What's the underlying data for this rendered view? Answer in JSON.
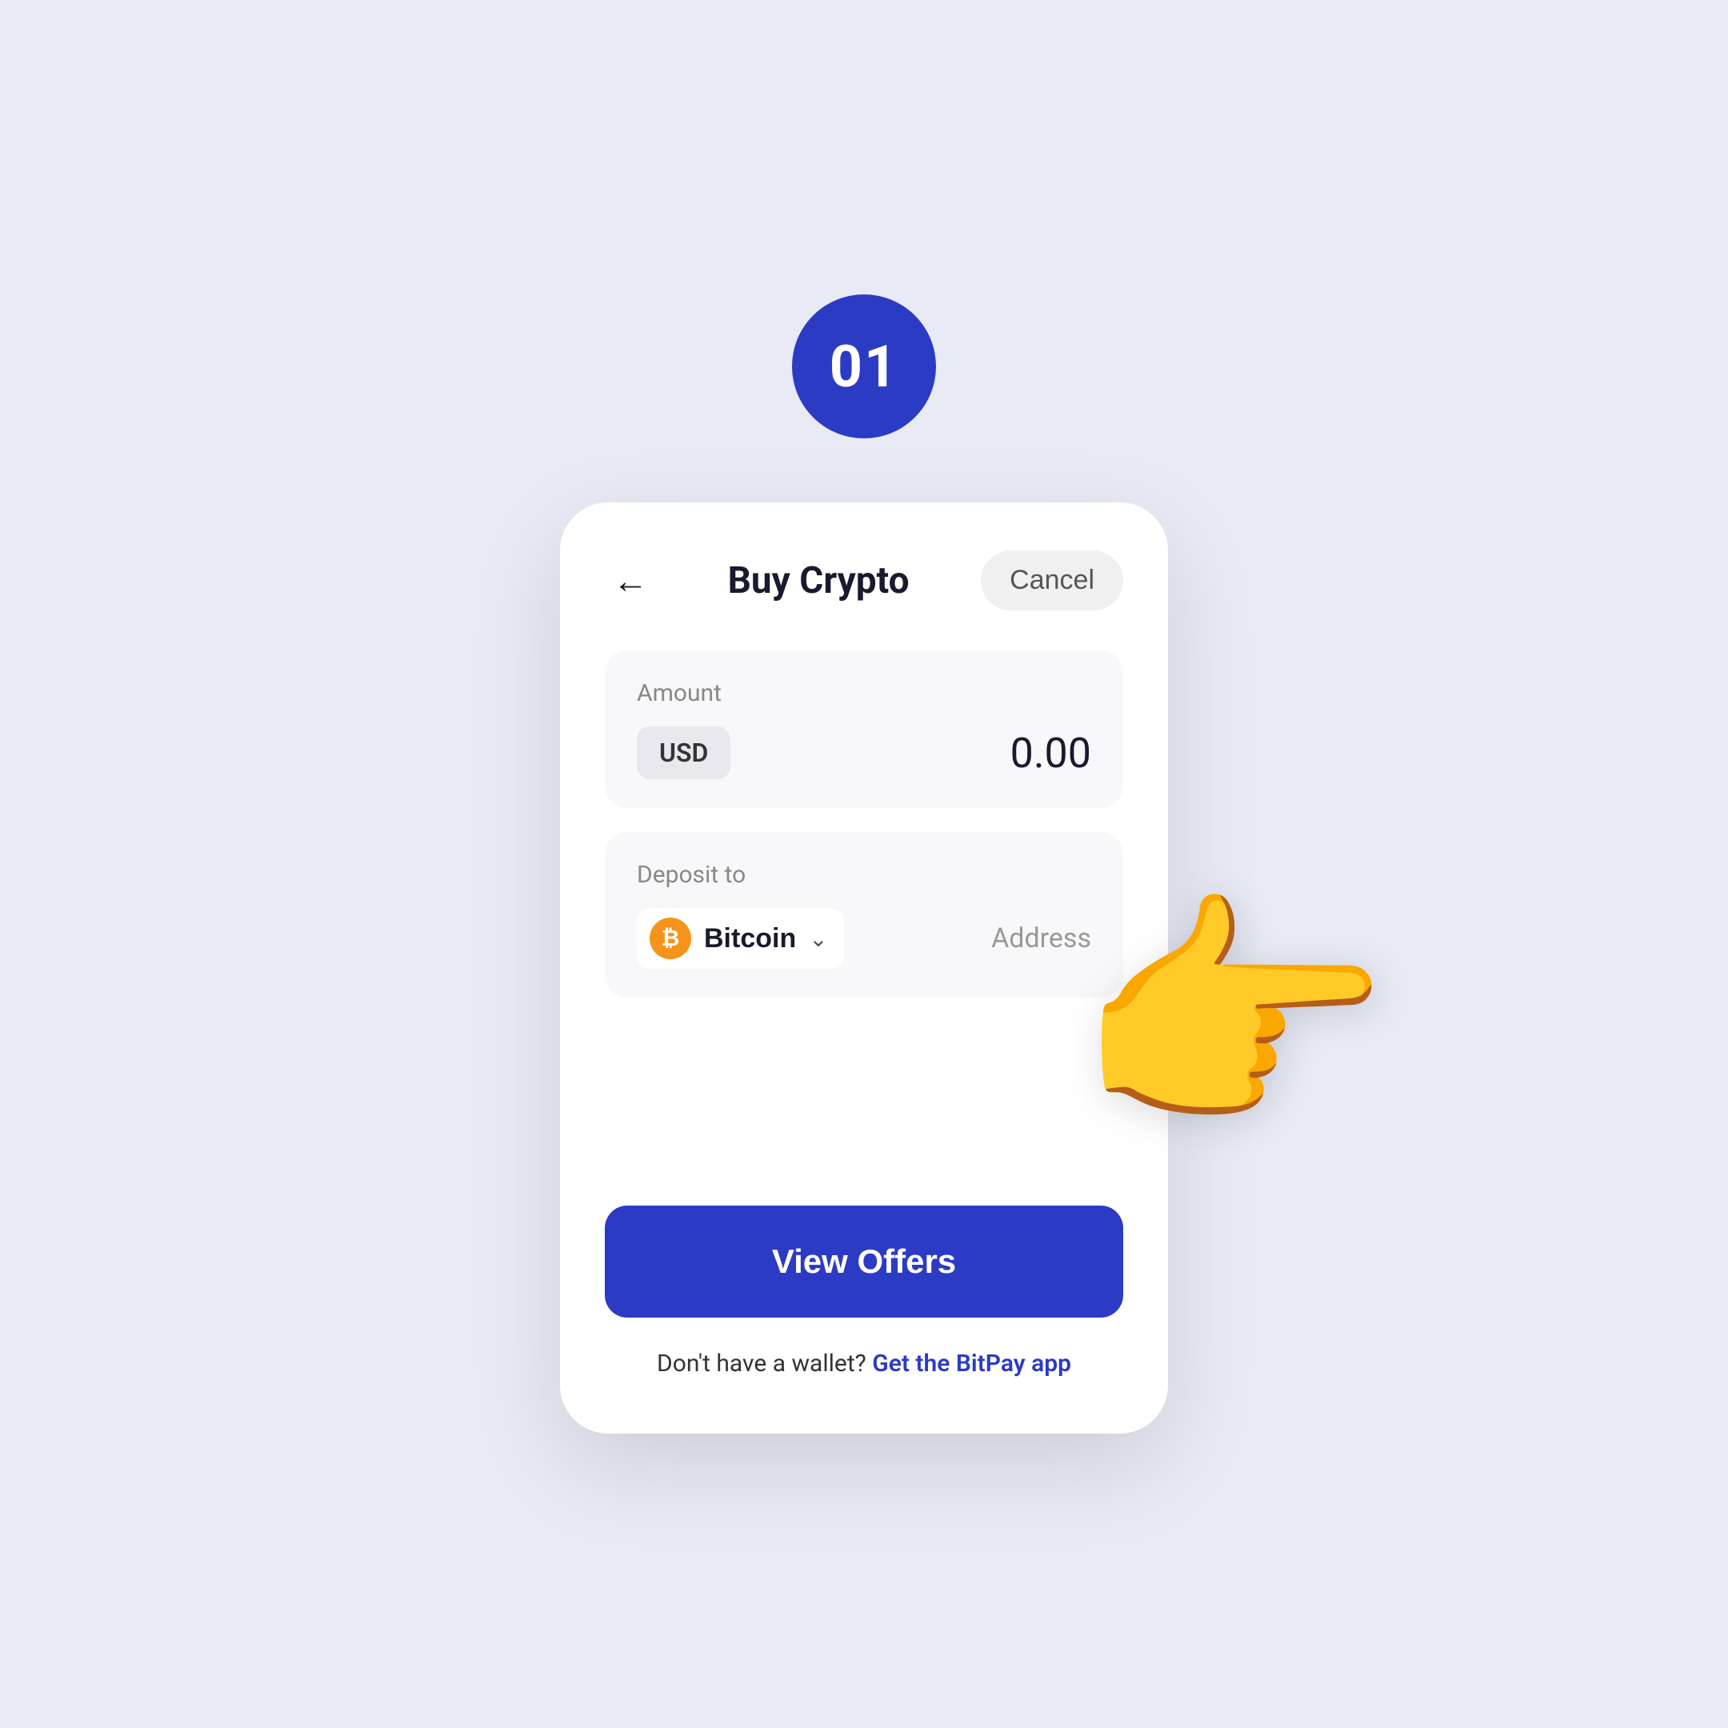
{
  "page": {
    "background_color": "#e8eaf6"
  },
  "step_badge": {
    "number": "01",
    "bg_color": "#2c3bc4",
    "text_color": "#ffffff"
  },
  "header": {
    "title": "Buy Crypto",
    "cancel_label": "Cancel",
    "back_aria": "Back"
  },
  "amount_section": {
    "label": "Amount",
    "currency": "USD",
    "value": "0.00"
  },
  "deposit_section": {
    "label": "Deposit to",
    "crypto_name": "Bitcoin",
    "address_label": "Address"
  },
  "actions": {
    "view_offers_label": "View Offers"
  },
  "footer": {
    "wallet_text": "Don't have a wallet?",
    "wallet_link": "Get the BitPay app"
  }
}
